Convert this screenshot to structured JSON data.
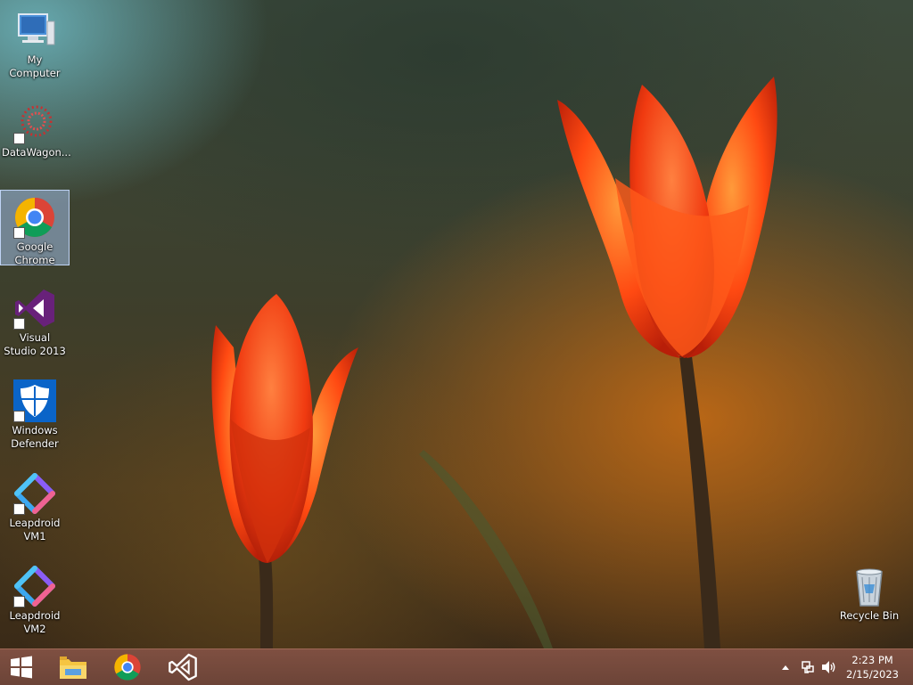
{
  "desktop": {
    "icons": [
      {
        "label": "My Computer",
        "icon": "computer-icon"
      },
      {
        "label": "DataWagon...",
        "icon": "datawagon-icon"
      },
      {
        "label": "Google Chrome",
        "icon": "chrome-icon",
        "selected": true
      },
      {
        "label": "Visual Studio 2013",
        "icon": "visual-studio-icon"
      },
      {
        "label": "Windows Defender",
        "icon": "windows-defender-icon"
      },
      {
        "label": "Leapdroid VM1",
        "icon": "leapdroid-icon"
      },
      {
        "label": "Leapdroid VM2",
        "icon": "leapdroid-icon"
      }
    ],
    "recycle_bin": {
      "label": "Recycle Bin",
      "icon": "recycle-bin-icon"
    }
  },
  "taskbar": {
    "pinned": [
      "start-button",
      "file-explorer-icon",
      "chrome-icon",
      "visual-studio-icon"
    ],
    "tray": {
      "time": "2:23 PM",
      "date": "2/15/2023",
      "icons": [
        "show-hidden-icons-arrow",
        "network-icon",
        "volume-icon"
      ]
    }
  },
  "colors": {
    "taskbar": "#6e4233",
    "flower": "#ff4a10",
    "selection": "#a0bee6"
  }
}
